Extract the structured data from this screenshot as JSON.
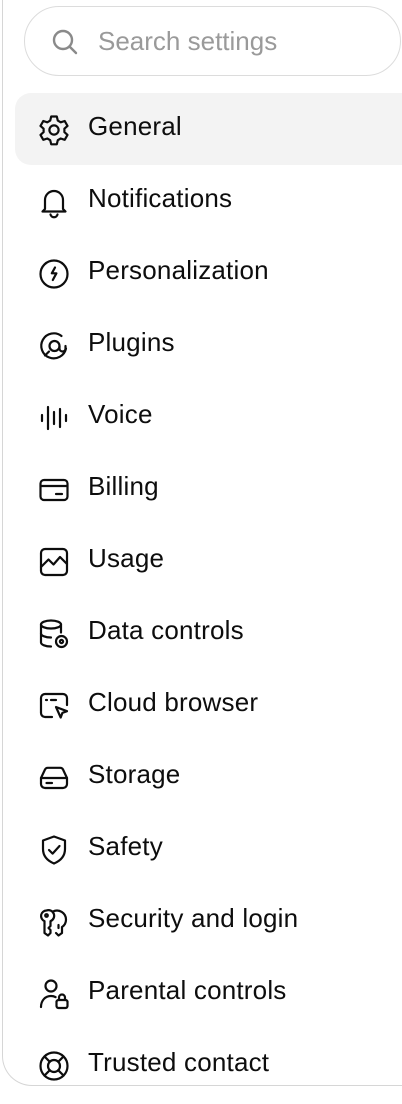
{
  "search": {
    "placeholder": "Search settings",
    "icon": "search-icon"
  },
  "nav": {
    "items": [
      {
        "label": "General",
        "icon": "gear-icon",
        "active": true
      },
      {
        "label": "Notifications",
        "icon": "bell-icon"
      },
      {
        "label": "Personalization",
        "icon": "personalization-icon"
      },
      {
        "label": "Plugins",
        "icon": "plugins-icon"
      },
      {
        "label": "Voice",
        "icon": "voice-waveform-icon"
      },
      {
        "label": "Billing",
        "icon": "credit-card-icon"
      },
      {
        "label": "Usage",
        "icon": "usage-chart-icon"
      },
      {
        "label": "Data controls",
        "icon": "database-gear-icon"
      },
      {
        "label": "Cloud browser",
        "icon": "cloud-browser-icon"
      },
      {
        "label": "Storage",
        "icon": "storage-drive-icon"
      },
      {
        "label": "Safety",
        "icon": "shield-check-icon"
      },
      {
        "label": "Security and login",
        "icon": "security-key-icon"
      },
      {
        "label": "Parental controls",
        "icon": "parental-lock-icon"
      },
      {
        "label": "Trusted contact",
        "icon": "lifebuoy-icon"
      }
    ]
  },
  "colors": {
    "text": "#0d0d0d",
    "placeholder": "#9a9a9a",
    "active_bg": "#f3f3f3",
    "border": "#dcdcdc"
  }
}
